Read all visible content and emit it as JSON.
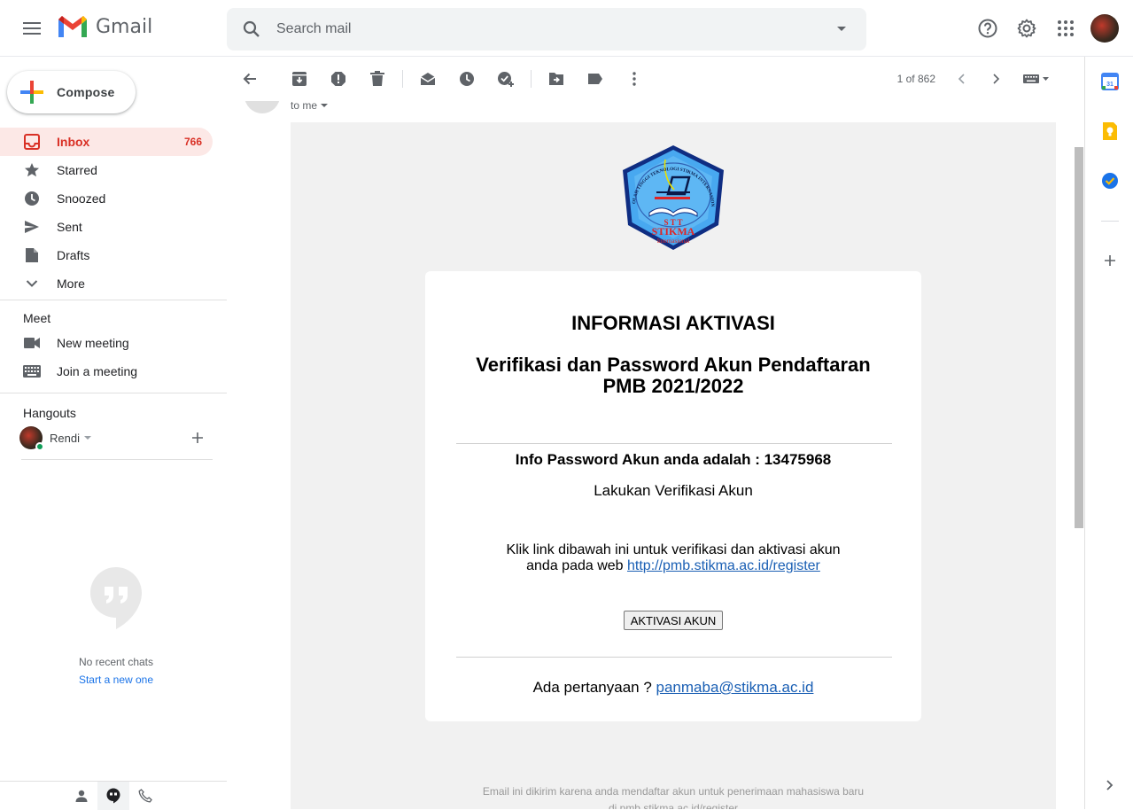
{
  "header": {
    "app_name": "Gmail",
    "search_placeholder": "Search mail"
  },
  "sidebar": {
    "compose_label": "Compose",
    "nav": [
      {
        "label": "Inbox",
        "count": "766",
        "icon": "inbox-icon"
      },
      {
        "label": "Starred",
        "count": "",
        "icon": "star-icon"
      },
      {
        "label": "Snoozed",
        "count": "",
        "icon": "clock-icon"
      },
      {
        "label": "Sent",
        "count": "",
        "icon": "send-icon"
      },
      {
        "label": "Drafts",
        "count": "",
        "icon": "draft-icon"
      },
      {
        "label": "More",
        "count": "",
        "icon": "chevron-down-icon"
      }
    ],
    "meet_title": "Meet",
    "meet_items": [
      "New meeting",
      "Join a meeting"
    ],
    "hangouts_title": "Hangouts",
    "hangouts_user": "Rendi",
    "no_chats": "No recent chats",
    "start_new": "Start a new one"
  },
  "toolbar": {
    "pager": "1 of 862"
  },
  "email": {
    "to_me": "to me",
    "title": "INFORMASI AKTIVASI",
    "subtitle_line1": "Verifikasi dan Password Akun Pendaftaran",
    "subtitle_line2": "PMB 2021/2022",
    "password_info": "Info Password Akun anda adalah : 13475968",
    "verify_text": "Lakukan Verifikasi Akun",
    "link_intro_1": "Klik link dibawah ini untuk verifikasi dan aktivasi akun",
    "link_intro_2": "anda pada web ",
    "link_url": "http://pmb.stikma.ac.id/register",
    "activate_button": "AKTIVASI AKUN",
    "question_text": "Ada pertanyaan ? ",
    "question_email": "panmaba@stikma.ac.id",
    "footer_line1": "Email ini dikirim karena anda mendaftar akun untuk penerimaan mahasiswa baru",
    "footer_line2_prefix": "di ",
    "footer_link": "pmb.stikma.ac.id/register",
    "crest": {
      "arc_text": "SEKOLAH TINGGI TEKNOLOGI STIKMA INTERNASIONAL",
      "stt": "S T T",
      "name": "STIKMA",
      "sub": "Internasional"
    }
  },
  "colors": {
    "inbox_active_bg": "#fce8e6",
    "inbox_active_text": "#d93025",
    "link": "#1a5fb4",
    "email_bg": "#f1f1f1"
  }
}
